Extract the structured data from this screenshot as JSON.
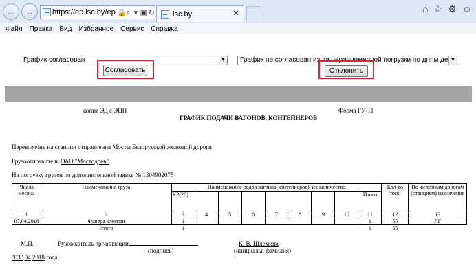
{
  "browser": {
    "address": "https://ep.isc.by/ep/GUI",
    "tab_title": "isc.by",
    "menu": [
      "Файл",
      "Правка",
      "Вид",
      "Избранное",
      "Сервис",
      "Справка"
    ]
  },
  "form": {
    "left_select_value": "График согласован",
    "right_select_value": "График не согласован из-за неравномерной погрузки по дням декады",
    "approve_label": "Согласовать",
    "reject_label": "Отклонить"
  },
  "document": {
    "copy_label": "копия ЭД с ЭЦП",
    "form_label": "Форма ГУ-11",
    "title": "ГРАФИК ПОДАЧИ ВАГОНОВ, КОНТЕЙНЕРОВ",
    "line1_prefix": "Перевозочну на станции отправления",
    "line1_station": "Мосты",
    "line1_suffix": "Белорусской железной дороги",
    "line2_prefix": "Грузоотправитель",
    "line2_shipper": "ОАО \"Мостодрев\"",
    "line3_prefix": "На погрузку грузов по",
    "line3_type": "дополнительной заявке №",
    "line3_number": "1304902075",
    "table": {
      "h_day": "Числа месяца",
      "h_cargo": "Наименование груза",
      "h_wagon_types": "Наименование родов вагонов(контейнеров), их количество",
      "h_kr": "КР(20)",
      "h_total": "Итого",
      "h_tons": "Кол-во тонн",
      "h_roads": "По железным дорогам (станциям) назначения",
      "col_numbers": [
        "1",
        "2",
        "3",
        "4",
        "5",
        "6",
        "7",
        "8",
        "9",
        "10",
        "11",
        "12",
        "13"
      ],
      "row_date": "07.04.2018",
      "row_cargo": "Фанера клееная",
      "row_kr": "1",
      "row_total": "1",
      "row_tons": "55",
      "row_road": "ЛГ",
      "sum_label": "Итого",
      "sum_kr": "1",
      "sum_total": "1",
      "sum_tons": "55"
    },
    "mp": "М.П.",
    "head_label": "Руководитель организации",
    "signature_caption": "(подпись)",
    "head_name": "К. В. Шлемина",
    "name_caption": "(инициалы, фамилия)",
    "date_day": "\"03\"",
    "date_month": "04",
    "date_year": "2018",
    "date_suffix": "года"
  }
}
